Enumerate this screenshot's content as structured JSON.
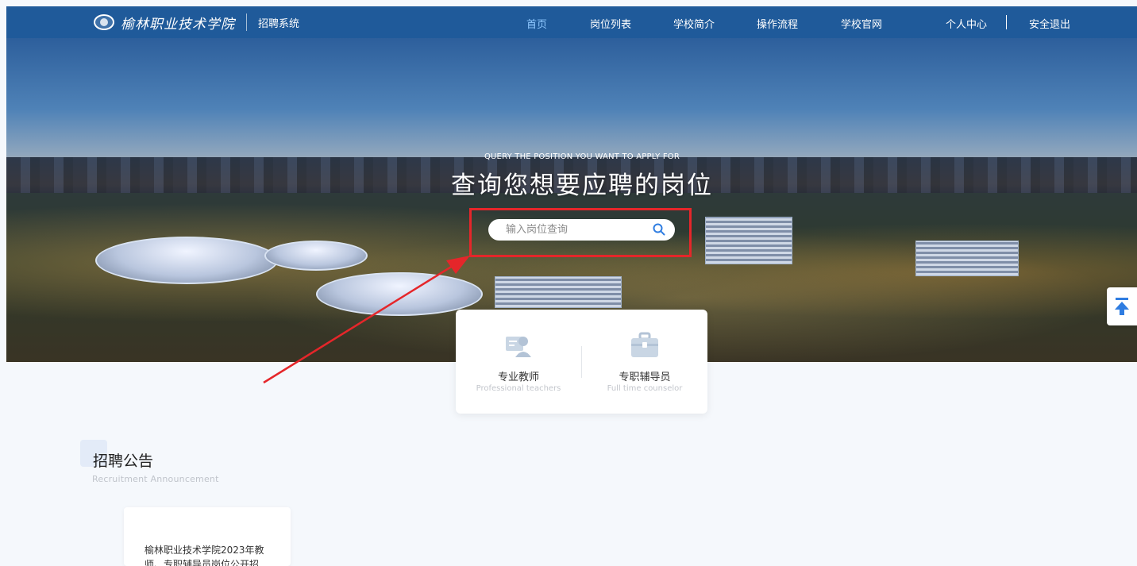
{
  "header": {
    "logo_text": "榆林职业技术学院",
    "system_name": "招聘系统",
    "nav": [
      {
        "label": "首页",
        "active": true
      },
      {
        "label": "岗位列表",
        "active": false
      },
      {
        "label": "学校简介",
        "active": false
      },
      {
        "label": "操作流程",
        "active": false
      },
      {
        "label": "学校官网",
        "active": false
      }
    ],
    "user_center": "个人中心",
    "logout": "安全退出"
  },
  "hero": {
    "subtitle": "QUERY THE POSITION YOU WANT TO APPLY FOR",
    "title": "查询您想要应聘的岗位",
    "search_placeholder": "输入岗位查询",
    "search_value": ""
  },
  "categories": [
    {
      "label": "专业教师",
      "en": "Professional teachers",
      "icon": "teacher-icon"
    },
    {
      "label": "专职辅导员",
      "en": "Full time counselor",
      "icon": "briefcase-icon"
    }
  ],
  "announcement": {
    "title": "招聘公告",
    "subtitle": "Recruitment Announcement",
    "items": [
      {
        "text": "榆林职业技术学院2023年教师、专职辅导员岗位公开招..."
      }
    ]
  },
  "colors": {
    "header_bg": "#1f5a9a",
    "active_nav": "#8fc8ff",
    "highlight": "#e5262a",
    "search_icon": "#2f7de1"
  }
}
